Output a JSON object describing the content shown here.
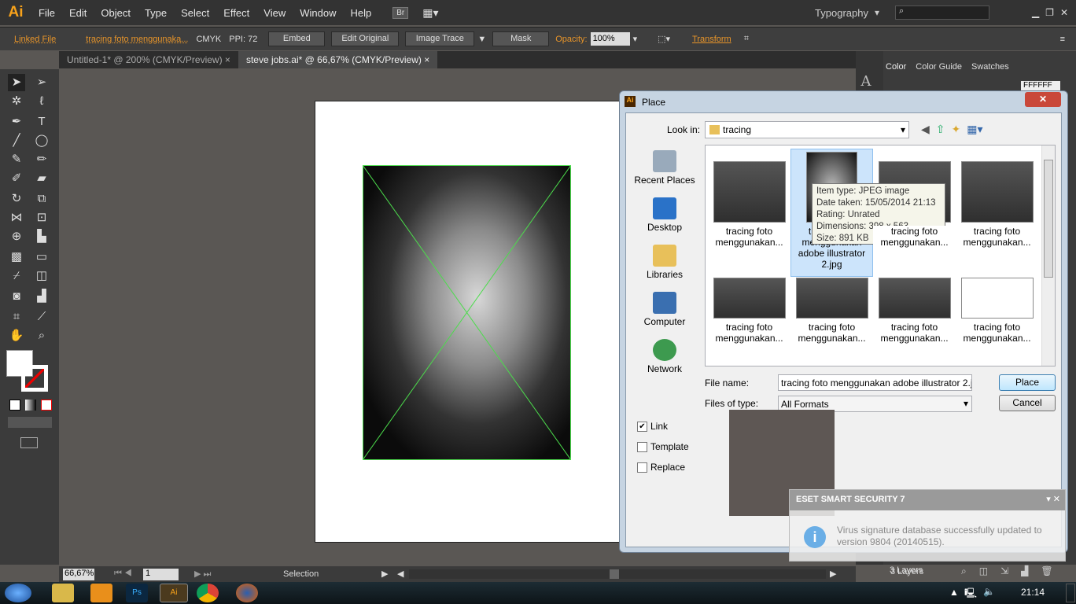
{
  "app": {
    "logo": "Ai",
    "menus": [
      "File",
      "Edit",
      "Object",
      "Type",
      "Select",
      "Effect",
      "View",
      "Window",
      "Help"
    ],
    "bridge": "Br",
    "workspace": "Typography",
    "search_placeholder": ""
  },
  "control": {
    "linked_file": "Linked File",
    "file_name": "tracing foto menggunaka...",
    "color_mode": "CMYK",
    "ppi": "PPI: 72",
    "embed": "Embed",
    "edit_original": "Edit Original",
    "image_trace": "Image Trace",
    "mask": "Mask",
    "opacity_label": "Opacity:",
    "opacity_value": "100%",
    "transform": "Transform"
  },
  "tabs": [
    {
      "label": "Untitled-1* @ 200% (CMYK/Preview)",
      "active": false
    },
    {
      "label": "steve jobs.ai* @ 66,67% (CMYK/Preview)",
      "active": true
    }
  ],
  "right_panel": {
    "tabs": [
      "Color",
      "Color Guide",
      "Swatches"
    ],
    "hex": "FFFFFF",
    "layers": "3 Layers"
  },
  "dialog": {
    "title": "Place",
    "look_in_label": "Look in:",
    "look_in_value": "tracing",
    "places": [
      "Recent Places",
      "Desktop",
      "Libraries",
      "Computer",
      "Network"
    ],
    "files": [
      "tracing foto menggunakan...",
      "tracing foto menggunakan adobe illustrator 2.jpg",
      "tracing foto menggunakan...",
      "tracing foto menggunakan...",
      "tracing foto menggunakan...",
      "tracing foto menggunakan...",
      "tracing foto menggunakan...",
      "tracing foto menggunakan..."
    ],
    "tooltip": [
      "Item type: JPEG image",
      "Date taken: 15/05/2014 21:13",
      "Rating: Unrated",
      "Dimensions: 398 x 563",
      "Size: 891 KB"
    ],
    "file_name_label": "File name:",
    "file_name_value": "tracing foto menggunakan adobe illustrator 2.jpg",
    "file_type_label": "Files of type:",
    "file_type_value": "All Formats",
    "place": "Place",
    "cancel": "Cancel",
    "options": [
      {
        "label": "Link",
        "checked": true
      },
      {
        "label": "Template",
        "checked": false
      },
      {
        "label": "Replace",
        "checked": false
      }
    ]
  },
  "eset": {
    "title": "ESET SMART SECURITY 7",
    "message": "Virus signature database successfully updated to version 9804 (20140515)."
  },
  "status": {
    "zoom": "66,67%",
    "page": "1",
    "tool": "Selection"
  },
  "taskbar": {
    "time": "21:14"
  }
}
